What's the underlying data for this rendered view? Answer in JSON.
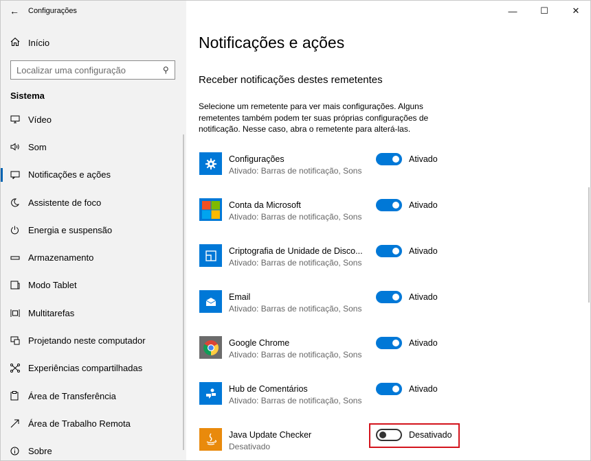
{
  "window": {
    "title": "Configurações",
    "controls": {
      "minimize": "—",
      "maximize": "☐",
      "close": "✕"
    }
  },
  "sidebar": {
    "home_label": "Início",
    "search_placeholder": "Localizar uma configuração",
    "section_title": "Sistema",
    "items": [
      {
        "label": "Vídeo",
        "icon": "monitor-icon"
      },
      {
        "label": "Som",
        "icon": "speaker-icon"
      },
      {
        "label": "Notificações e ações",
        "icon": "notification-icon",
        "active": true
      },
      {
        "label": "Assistente de foco",
        "icon": "moon-icon"
      },
      {
        "label": "Energia e suspensão",
        "icon": "power-icon"
      },
      {
        "label": "Armazenamento",
        "icon": "storage-icon"
      },
      {
        "label": "Modo Tablet",
        "icon": "tablet-icon"
      },
      {
        "label": "Multitarefas",
        "icon": "multitask-icon"
      },
      {
        "label": "Projetando neste computador",
        "icon": "project-icon"
      },
      {
        "label": "Experiências compartilhadas",
        "icon": "share-icon"
      },
      {
        "label": "Área de Transferência",
        "icon": "clipboard-icon"
      },
      {
        "label": "Área de Trabalho Remota",
        "icon": "remote-icon"
      },
      {
        "label": "Sobre",
        "icon": "info-icon"
      }
    ]
  },
  "main": {
    "page_title": "Notificações e ações",
    "sub_title": "Receber notificações destes remetentes",
    "description": "Selecione um remetente para ver mais configurações. Alguns remetentes também podem ter suas próprias configurações de notificação. Nesse caso, abra o remetente para alterá-las.",
    "senders": [
      {
        "name": "Configurações",
        "status": "Ativado: Barras de notificação, Sons",
        "toggle": "Ativado",
        "on": true,
        "icon": "settings-gear-icon",
        "color": "#0078d7"
      },
      {
        "name": "Conta da Microsoft",
        "status": "Ativado: Barras de notificação, Sons",
        "toggle": "Ativado",
        "on": true,
        "icon": "microsoft-logo-icon",
        "color": "#0078d7"
      },
      {
        "name": "Criptografia de Unidade de Disco...",
        "status": "Ativado: Barras de notificação, Sons",
        "toggle": "Ativado",
        "on": true,
        "icon": "bitlocker-icon",
        "color": "#0078d7"
      },
      {
        "name": "Email",
        "status": "Ativado: Barras de notificação, Sons",
        "toggle": "Ativado",
        "on": true,
        "icon": "mail-icon",
        "color": "#0078d7"
      },
      {
        "name": "Google Chrome",
        "status": "Ativado: Barras de notificação, Sons",
        "toggle": "Ativado",
        "on": true,
        "icon": "chrome-logo-icon",
        "color": "#6b6b6b"
      },
      {
        "name": "Hub de Comentários",
        "status": "Ativado: Barras de notificação, Sons",
        "toggle": "Ativado",
        "on": true,
        "icon": "feedback-hub-icon",
        "color": "#0078d7"
      },
      {
        "name": "Java Update Checker",
        "status": "Desativado",
        "toggle": "Desativado",
        "on": false,
        "icon": "java-logo-icon",
        "color": "#e98a0c",
        "highlighted": true
      }
    ]
  }
}
